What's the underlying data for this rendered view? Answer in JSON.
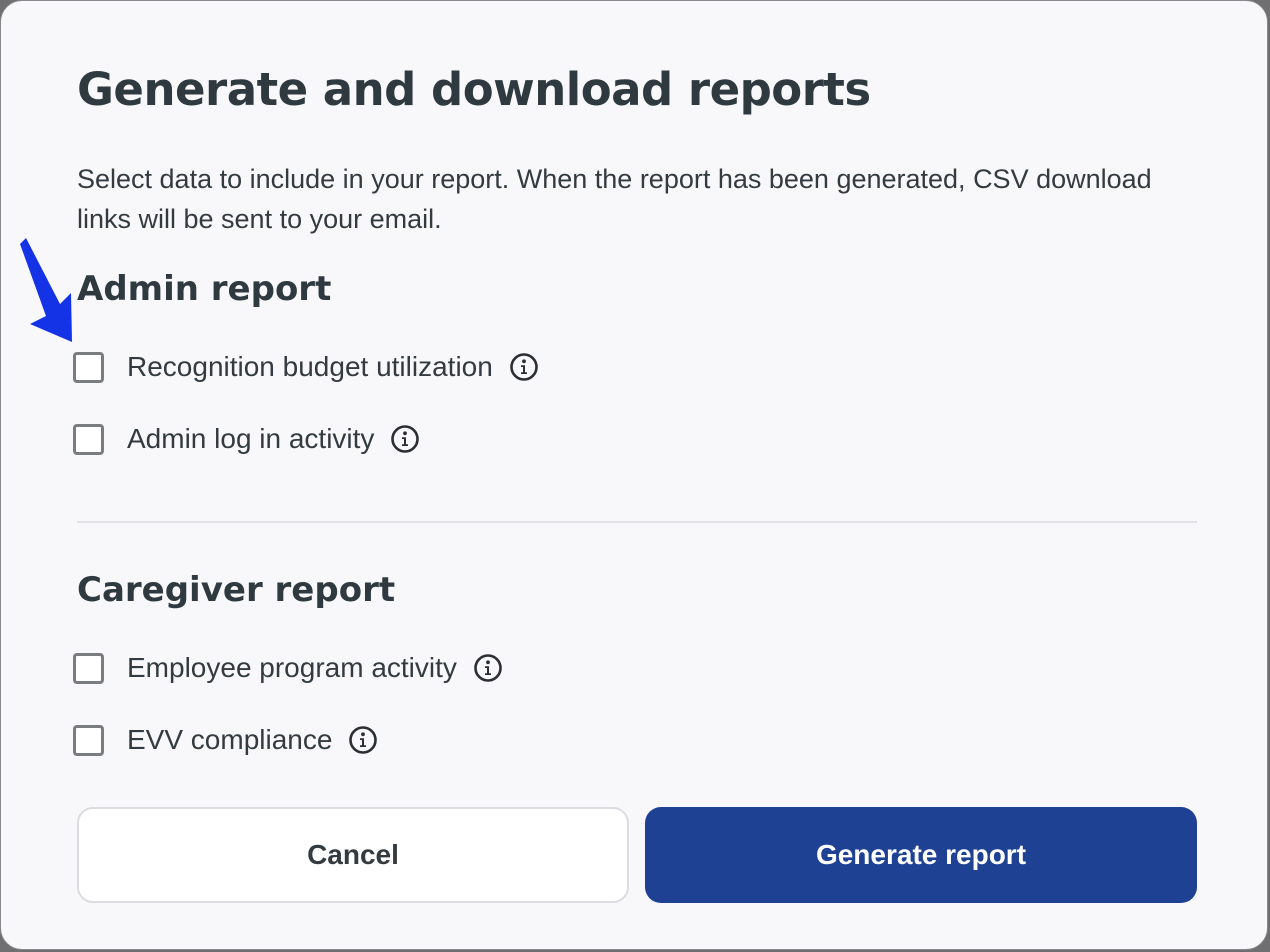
{
  "dialog": {
    "title": "Generate and download reports",
    "description": "Select data to include in your report. When the report has been generated, CSV download links will be sent to your email."
  },
  "admin_report": {
    "title": "Admin report",
    "options": [
      {
        "label": "Recognition budget utilization",
        "checked": false
      },
      {
        "label": "Admin log in activity",
        "checked": false
      }
    ]
  },
  "caregiver_report": {
    "title": "Caregiver report",
    "options": [
      {
        "label": "Employee program activity",
        "checked": false
      },
      {
        "label": "EVV compliance",
        "checked": false
      }
    ]
  },
  "buttons": {
    "cancel_label": "Cancel",
    "generate_label": "Generate report"
  },
  "colors": {
    "primary": "#1f4194",
    "text": "#333b41",
    "heading": "#2f3a40",
    "background": "#f8f8fa",
    "annotation_arrow": "#1433e6"
  },
  "icons": {
    "info": "info-circle-icon",
    "annotation": "arrow-down-left-icon"
  }
}
